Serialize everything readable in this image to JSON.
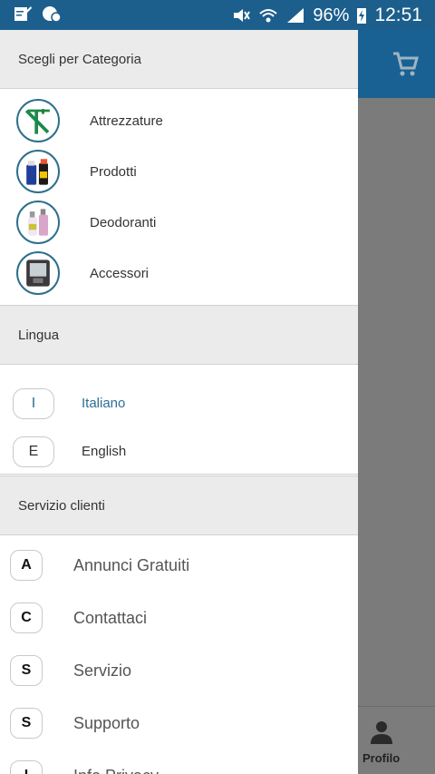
{
  "status_bar": {
    "battery_percent": "96%",
    "time": "12:51"
  },
  "drawer": {
    "categories": {
      "header": "Scegli per Categoria",
      "items": [
        {
          "label": "Attrezzature",
          "icon": "tools-icon"
        },
        {
          "label": "Prodotti",
          "icon": "cleaning-products-icon"
        },
        {
          "label": "Deodoranti",
          "icon": "deodorant-icon"
        },
        {
          "label": "Accessori",
          "icon": "dispenser-icon"
        }
      ]
    },
    "language": {
      "header": "Lingua",
      "items": [
        {
          "badge": "I",
          "label": "Italiano",
          "active": true
        },
        {
          "badge": "E",
          "label": "English",
          "active": false
        }
      ]
    },
    "service": {
      "header": "Servizio clienti",
      "items": [
        {
          "badge": "A",
          "label": "Annunci Gratuiti"
        },
        {
          "badge": "C",
          "label": "Contattaci"
        },
        {
          "badge": "S",
          "label": "Servizio"
        },
        {
          "badge": "S",
          "label": "Supporto"
        },
        {
          "badge": "I",
          "label": "Info Privacy"
        }
      ]
    }
  },
  "background_app": {
    "bottom_nav": {
      "profile_label": "Profilo"
    }
  },
  "colors": {
    "primary": "#1a6193",
    "active_text": "#2d6f96"
  }
}
